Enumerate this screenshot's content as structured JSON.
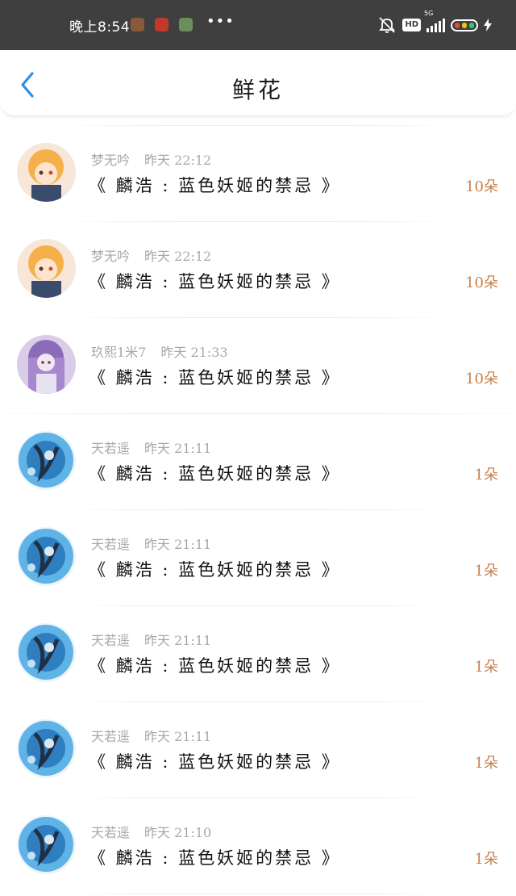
{
  "status_bar": {
    "time": "晚上8:54",
    "more": "•••",
    "hd": "HD",
    "network": "5G"
  },
  "header": {
    "title": "鲜花",
    "back_icon": "chevron-left-icon"
  },
  "colors": {
    "accent_blue": "#2f8fe6",
    "amount_orange": "#c87f4c",
    "meta_gray": "#a7a7a7",
    "status_bar_bg": "#3f3f3f"
  },
  "gifts": [
    {
      "user": "梦无吟",
      "time": "昨天 22:12",
      "book": "《 麟浩 : 蓝色妖姬的禁忌 》",
      "amount": "10朵",
      "avatar": "anime-girl-orange-hair"
    },
    {
      "user": "梦无吟",
      "time": "昨天 22:12",
      "book": "《 麟浩 : 蓝色妖姬的禁忌 》",
      "amount": "10朵",
      "avatar": "anime-girl-orange-hair"
    },
    {
      "user": "玖熙1米7",
      "time": "昨天 21:33",
      "book": "《 麟浩 : 蓝色妖姬的禁忌 》",
      "amount": "10朵",
      "avatar": "anime-girl-purple-hair"
    },
    {
      "user": "天若遥",
      "time": "昨天 21:11",
      "book": "《 麟浩 : 蓝色妖姬的禁忌 》",
      "amount": "1朵",
      "avatar": "anime-figure-blue-water"
    },
    {
      "user": "天若遥",
      "time": "昨天 21:11",
      "book": "《 麟浩 : 蓝色妖姬的禁忌 》",
      "amount": "1朵",
      "avatar": "anime-figure-blue-water"
    },
    {
      "user": "天若遥",
      "time": "昨天 21:11",
      "book": "《 麟浩 : 蓝色妖姬的禁忌 》",
      "amount": "1朵",
      "avatar": "anime-figure-blue-water"
    },
    {
      "user": "天若遥",
      "time": "昨天 21:11",
      "book": "《 麟浩 : 蓝色妖姬的禁忌 》",
      "amount": "1朵",
      "avatar": "anime-figure-blue-water"
    },
    {
      "user": "天若遥",
      "time": "昨天 21:10",
      "book": "《 麟浩 : 蓝色妖姬的禁忌 》",
      "amount": "1朵",
      "avatar": "anime-figure-blue-water"
    }
  ]
}
